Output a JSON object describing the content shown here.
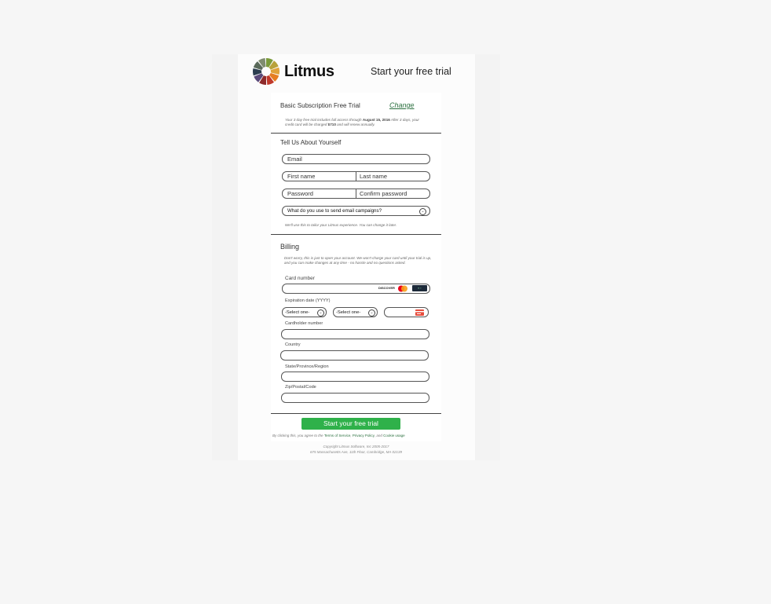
{
  "header": {
    "brand": "Litmus",
    "headline": "Start your free trial",
    "logo_colors": [
      "#7a9a3a",
      "#b8a23a",
      "#e0a33a",
      "#e67e22",
      "#c0392b",
      "#8e2b2b",
      "#5a4a7a",
      "#2c3e50",
      "#5a6a5a",
      "#7f8c6f"
    ]
  },
  "plan": {
    "name": "Basic Subscription Free Trial",
    "change_label": "Change",
    "note_pre": "Your 3 day free trial includes full access through",
    "note_date": "August 15, 2016",
    "note_mid": "After 3 days, your credit card will be charged",
    "note_amount": "$710",
    "note_post": "and will renew annually."
  },
  "about": {
    "heading": "Tell Us About Yourself",
    "email_ph": "Email",
    "first_ph": "First name",
    "last_ph": "Last name",
    "password_ph": "Password",
    "confirm_ph": "Confirm password",
    "select_question": "What do you use to send email campaigns?",
    "help": "We'll use this to tailor your Litmus experience. You can change it later."
  },
  "billing": {
    "heading": "Billing",
    "note": "Don't worry, this is just to open your account. We won't charge your card until your trial is up, and you can make changes at any time - no hassle and no questions asked.",
    "card_label": "Card number",
    "card_brands": [
      "DISCOVER",
      "Mastercard",
      "AMEX"
    ],
    "expiry_label": "Expiration date (YYYY)",
    "month_ph": "-Select one-",
    "year_ph": "-Select one-",
    "cvc_icon": "cvc-card-icon",
    "cardholder_label": "Cardholder number",
    "country_label": "Country",
    "state_label": "State/Province/Region",
    "zip_label": "Zip/Postal/Code"
  },
  "submit": {
    "label": "Start your free trial",
    "terms_pre": "By clicking this, you agree to the",
    "terms_link": "Terms of Service",
    "privacy_link": "Privacy Policy",
    "and": ", and",
    "cookie_link": "Cookie usage"
  },
  "footer": {
    "copyright": "Copyright Litmus Software, Inc 2005-2017",
    "address": "675 Massachusetts Ave, 11th Floor, Cambridge, MA 02139"
  },
  "colors": {
    "accent": "#2fb14a",
    "link": "#2a6f3e"
  }
}
